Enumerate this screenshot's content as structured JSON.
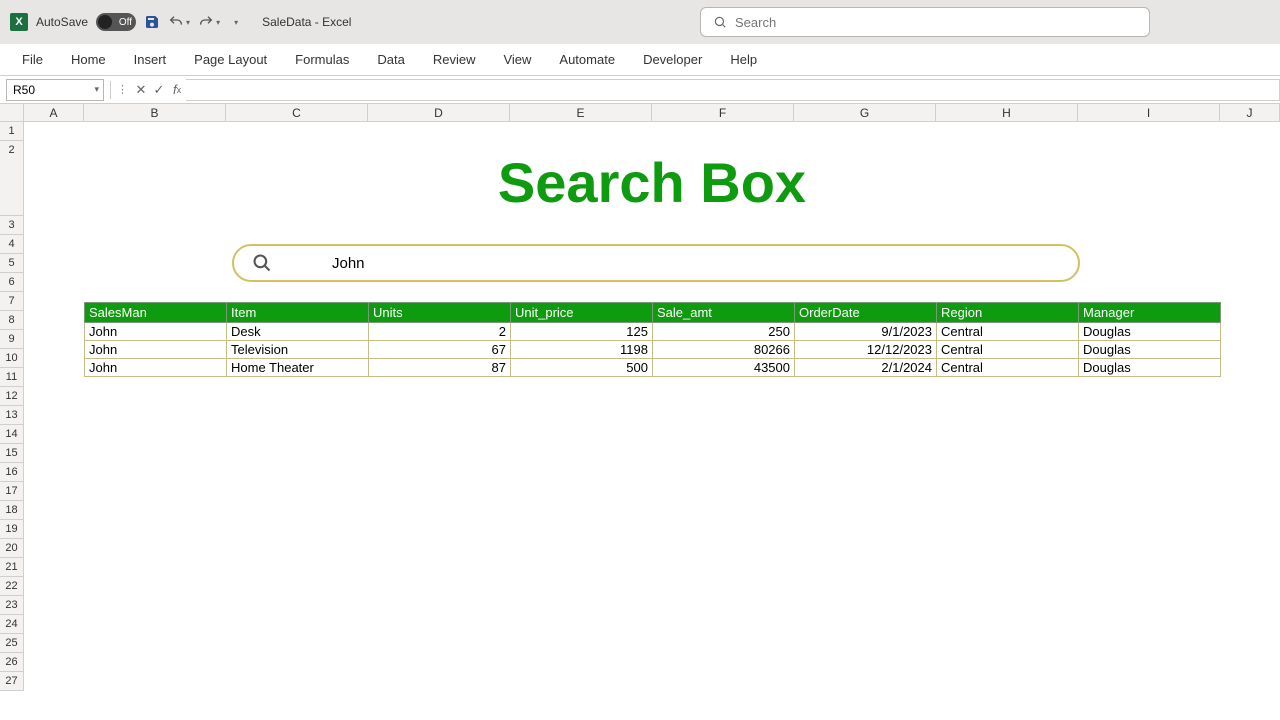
{
  "titlebar": {
    "autosave_label": "AutoSave",
    "autosave_state": "Off",
    "doc_title": "SaleData - Excel",
    "search_placeholder": "Search"
  },
  "ribbon": {
    "tabs": [
      "File",
      "Home",
      "Insert",
      "Page Layout",
      "Formulas",
      "Data",
      "Review",
      "View",
      "Automate",
      "Developer",
      "Help"
    ]
  },
  "formula_bar": {
    "name_box": "R50",
    "formula": ""
  },
  "columns": [
    "A",
    "B",
    "C",
    "D",
    "E",
    "F",
    "G",
    "H",
    "I",
    "J"
  ],
  "rows": [
    "1",
    "2",
    "3",
    "4",
    "5",
    "6",
    "7",
    "8",
    "9",
    "10",
    "11",
    "12",
    "13",
    "14",
    "15",
    "16",
    "17",
    "18",
    "19",
    "20",
    "21",
    "22",
    "23",
    "24",
    "25",
    "26",
    "27"
  ],
  "sheet": {
    "title": "Search Box",
    "search_value": "John",
    "table": {
      "headers": [
        "SalesMan",
        "Item",
        "Units",
        "Unit_price",
        "Sale_amt",
        "OrderDate",
        "Region",
        "Manager"
      ],
      "rows": [
        {
          "salesman": "John",
          "item": "Desk",
          "units": "2",
          "unit_price": "125",
          "sale_amt": "250",
          "orderdate": "9/1/2023",
          "region": "Central",
          "manager": "Douglas"
        },
        {
          "salesman": "John",
          "item": "Television",
          "units": "67",
          "unit_price": "1198",
          "sale_amt": "80266",
          "orderdate": "12/12/2023",
          "region": "Central",
          "manager": "Douglas"
        },
        {
          "salesman": "John",
          "item": "Home Theater",
          "units": "87",
          "unit_price": "500",
          "sale_amt": "43500",
          "orderdate": "2/1/2024",
          "region": "Central",
          "manager": "Douglas"
        }
      ]
    }
  },
  "colors": {
    "green": "#0f9b0f",
    "header_green": "#0f9b0f",
    "search_border": "#d4c060"
  }
}
